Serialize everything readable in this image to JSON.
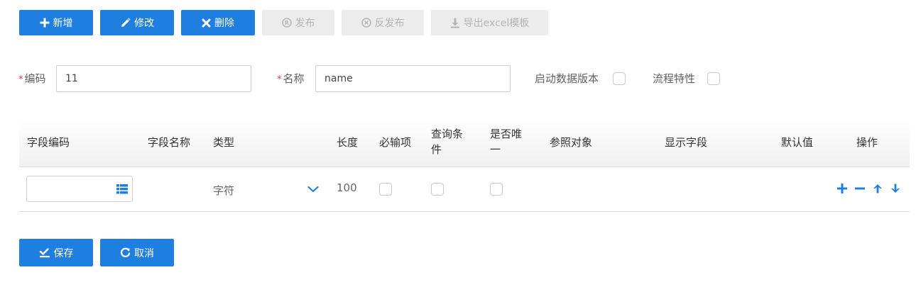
{
  "toolbar": {
    "add": "新增",
    "edit": "修改",
    "delete": "删除",
    "publish": "发布",
    "unpublish": "反发布",
    "export": "导出excel模板"
  },
  "form": {
    "required_mark": "*",
    "code_label": "编码",
    "code_value": "11",
    "name_label": "名称",
    "name_value": "name",
    "enable_version_label": "启动数据版本",
    "enable_version_checked": false,
    "process_label": "流程特性",
    "process_checked": false
  },
  "table": {
    "headers": {
      "field_code": "字段编码",
      "field_name": "字段名称",
      "type": "类型",
      "length": "长度",
      "required_l1": "必输项",
      "query_l1": "查询条",
      "query_l2": "件",
      "unique_l1": "是否唯",
      "unique_l2": "一",
      "ref_object": "参照对象",
      "display_field": "显示字段",
      "default_value": "默认值",
      "actions": "操作"
    },
    "rows": [
      {
        "field_code": "",
        "field_name": "",
        "type": "字符",
        "length": "100",
        "required": false,
        "query": false,
        "unique": false,
        "ref_object": "",
        "display_field": "",
        "default_value": ""
      }
    ]
  },
  "footer": {
    "save": "保存",
    "cancel": "取消"
  },
  "colors": {
    "primary": "#1e7fe0",
    "disabled_bg": "#ececec",
    "disabled_text": "#b4b4b4",
    "required": "#e53935"
  },
  "icons": {
    "add": "plus-icon",
    "edit": "pencil-icon",
    "delete": "x-icon",
    "publish": "registered-circle-icon",
    "unpublish": "x-circle-icon",
    "export": "download-icon",
    "picker": "list-icon",
    "dropdown": "chevron-down-icon",
    "row_add": "plus-icon",
    "row_remove": "minus-icon",
    "row_up": "arrow-up-icon",
    "row_down": "arrow-down-icon",
    "save": "check-save-icon",
    "cancel": "refresh-icon"
  }
}
